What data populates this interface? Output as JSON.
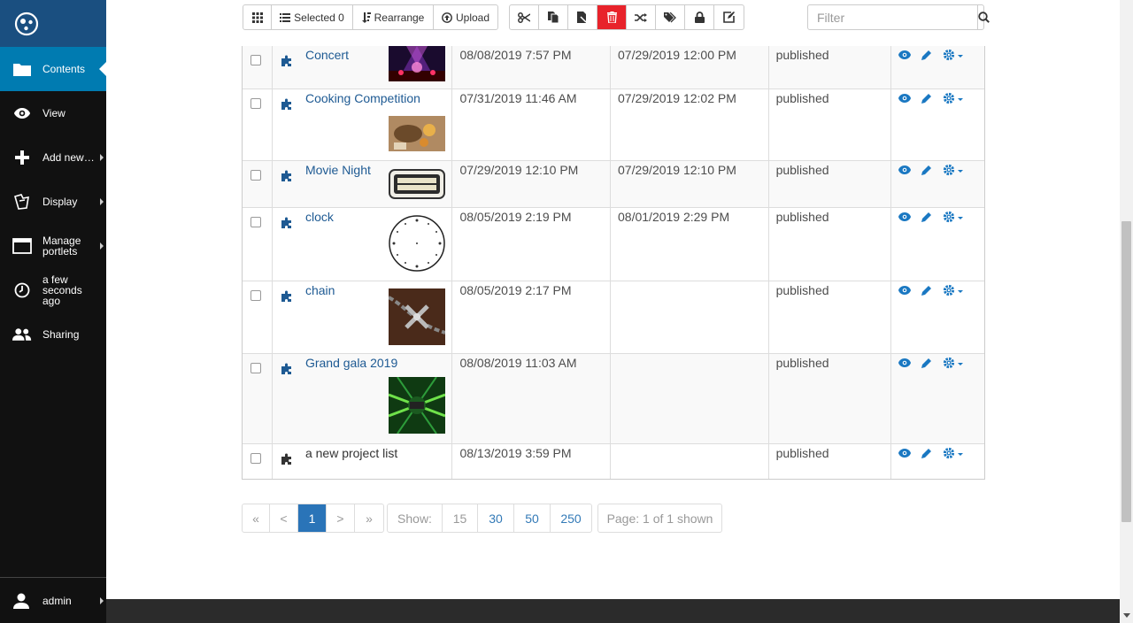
{
  "sidebar": {
    "items": [
      {
        "label": "Contents",
        "icon": "folder-icon"
      },
      {
        "label": "View",
        "icon": "eye-icon"
      },
      {
        "label": "Add new…",
        "icon": "plus-icon"
      },
      {
        "label": "Display",
        "icon": "display-icon"
      },
      {
        "label": "Manage\nportlets",
        "icon": "window-icon"
      },
      {
        "label": "a few\nseconds\nago",
        "icon": "clock-icon"
      },
      {
        "label": "Sharing",
        "icon": "users-icon"
      }
    ],
    "user_label": "admin"
  },
  "toolbar": {
    "selected_label": "Selected 0",
    "rearrange_label": "Rearrange",
    "upload_label": "Upload",
    "filter_placeholder": "Filter",
    "danger_color": "#e8232b"
  },
  "table": {
    "rows": [
      {
        "title": "Concert",
        "modified": "08/08/2019 7:57 PM",
        "published": "07/29/2019 12:00 PM",
        "state": "published",
        "thumb": "concert"
      },
      {
        "title": "Cooking Competition",
        "modified": "07/31/2019 11:46 AM",
        "published": "07/29/2019 12:02 PM",
        "state": "published",
        "thumb": "cooking"
      },
      {
        "title": "Movie Night",
        "modified": "07/29/2019 12:10 PM",
        "published": "07/29/2019 12:10 PM",
        "state": "published",
        "thumb": "movie"
      },
      {
        "title": "clock",
        "modified": "08/05/2019 2:19 PM",
        "published": "08/01/2019 2:29 PM",
        "state": "published",
        "thumb": "clock"
      },
      {
        "title": "chain",
        "modified": "08/05/2019 2:17 PM",
        "published": "",
        "state": "published",
        "thumb": "chain"
      },
      {
        "title": "Grand gala 2019",
        "modified": "08/08/2019 11:03 AM",
        "published": "",
        "state": "published",
        "thumb": "gala"
      },
      {
        "title": "a new project list",
        "modified": "08/13/2019 3:59 PM",
        "published": "",
        "state": "published",
        "thumb": ""
      }
    ]
  },
  "pagination": {
    "first": "«",
    "prev": "<",
    "current": "1",
    "next": ">",
    "last": "»",
    "show_label": "Show:",
    "sizes": [
      "15",
      "30",
      "50",
      "250"
    ],
    "page_info": "Page: 1 of 1 shown"
  },
  "colors": {
    "link": "#1e5a93",
    "active_nav": "#007bb1",
    "action_icon": "#1a78c2"
  }
}
